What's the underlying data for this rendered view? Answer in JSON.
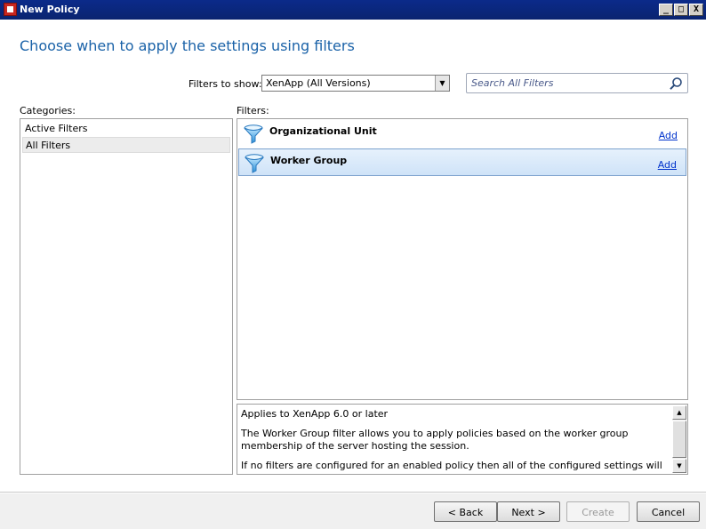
{
  "window": {
    "title": "New Policy",
    "controls": {
      "minimize": "_",
      "maximize": "□",
      "close": "X"
    }
  },
  "heading": "Choose when to apply the settings using filters",
  "filters_to_show": {
    "label": "Filters to show:",
    "selected": "XenApp (All Versions)"
  },
  "search": {
    "placeholder": "Search All Filters",
    "value": ""
  },
  "categories": {
    "label": "Categories:",
    "items": [
      {
        "label": "Active Filters",
        "selected": false
      },
      {
        "label": "All Filters",
        "selected": true
      }
    ]
  },
  "filters": {
    "label": "Filters:",
    "items": [
      {
        "name": "Organizational Unit",
        "action": "Add",
        "selected": false,
        "icon": "funnel-icon"
      },
      {
        "name": "Worker Group",
        "action": "Add",
        "selected": true,
        "icon": "funnel-icon"
      }
    ]
  },
  "description": {
    "paragraphs": [
      "Applies to XenApp 6.0 or later",
      "The Worker Group filter allows you to apply policies based on the worker group membership of the server hosting the session.",
      "If no filters are configured for an enabled policy then all of the configured settings will be applied"
    ]
  },
  "buttons": {
    "back": "< Back",
    "next": "Next >",
    "create": "Create",
    "cancel": "Cancel"
  },
  "colors": {
    "heading": "#1a62a8",
    "titlebar": "#0b2a8a",
    "selection": "#cfe3f8",
    "link": "#0033cc"
  }
}
